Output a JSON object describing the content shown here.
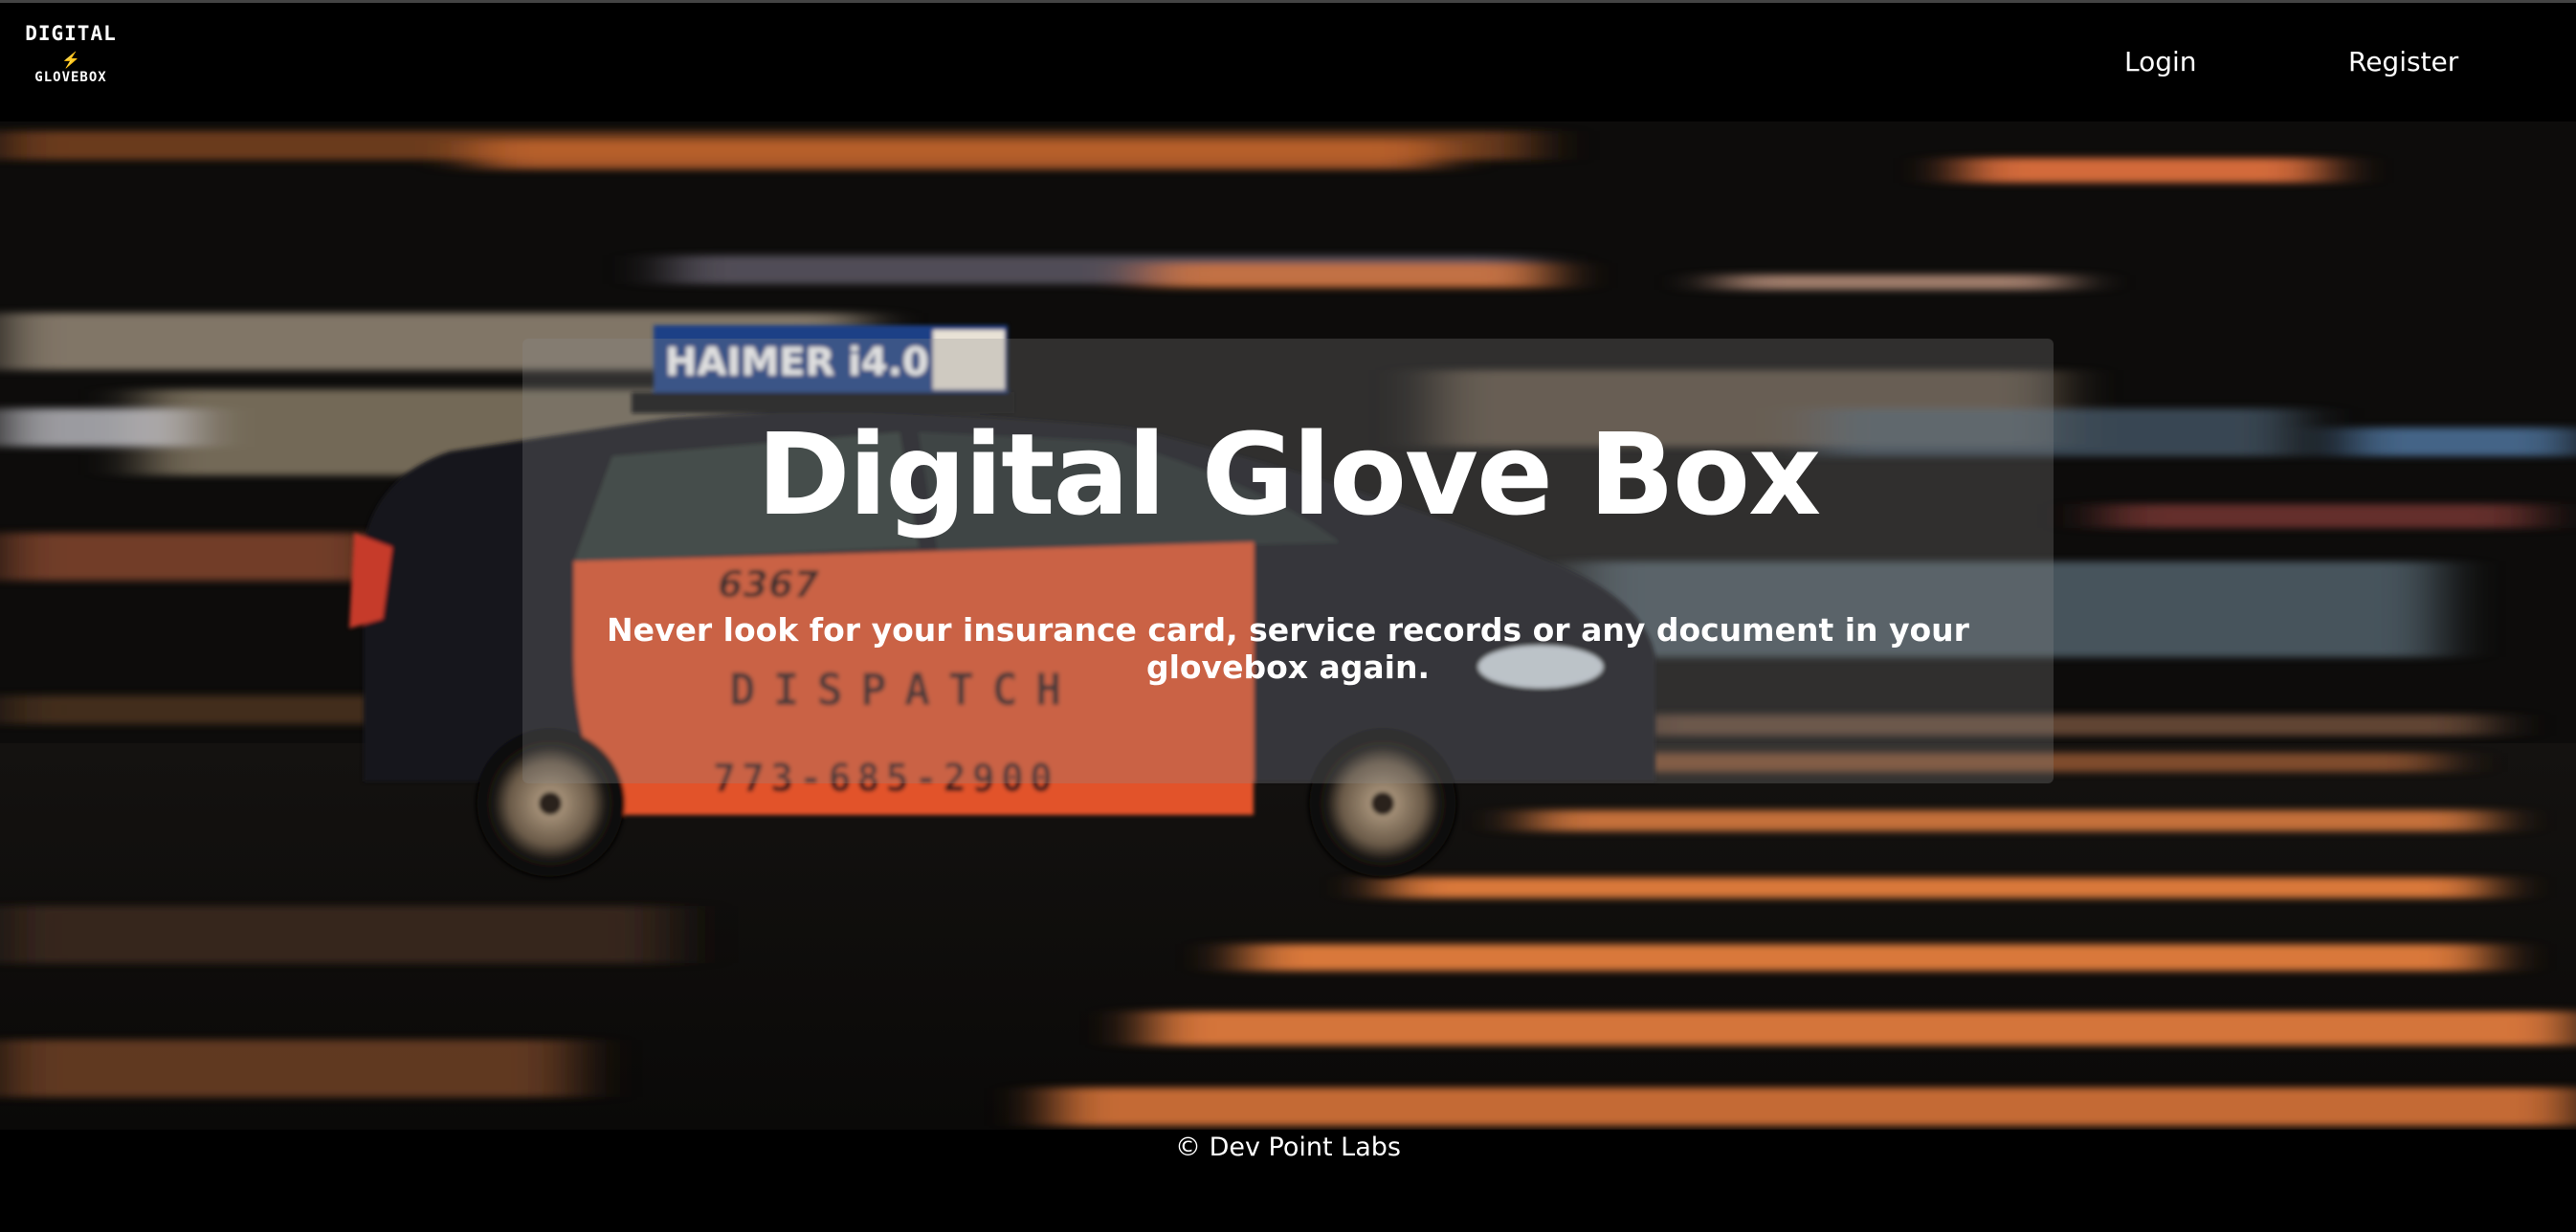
{
  "navbar": {
    "logo": {
      "text_top": "DIGITAL",
      "text_bottom": "GLOVEBOX",
      "icon": "lightning-bolt-icon"
    },
    "links": {
      "login": "Login",
      "register": "Register"
    }
  },
  "hero": {
    "title": "Digital Glove Box",
    "subtitle": "Never look for your insurance card, service records or any document in your glovebox again.",
    "image": {
      "taxi_roof_sign": "HAIMER i4.0",
      "taxi_number": "6367",
      "taxi_door_text": "DISPATCH",
      "taxi_phone": "773-685-2900"
    }
  },
  "footer": {
    "copyright": "© Dev Point Labs"
  },
  "colors": {
    "background": "#000000",
    "taxi_orange": "#e2532c",
    "streak_orange": "#d9783a",
    "text": "#ffffff"
  }
}
